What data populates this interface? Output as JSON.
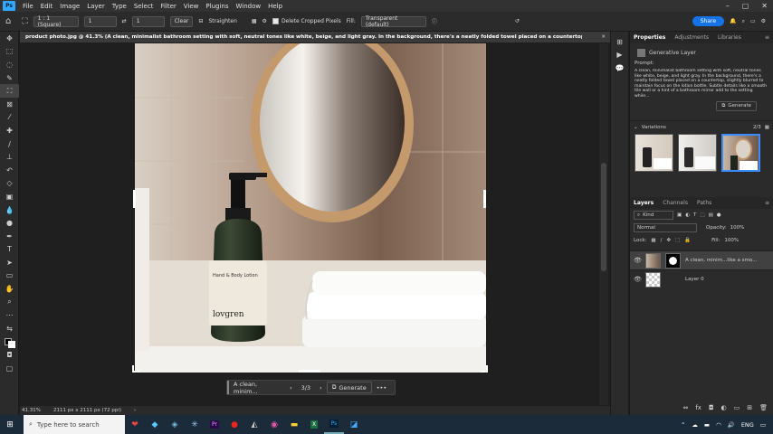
{
  "menubar": {
    "logo": "Ps",
    "items": [
      "File",
      "Edit",
      "Image",
      "Layer",
      "Type",
      "Select",
      "Filter",
      "View",
      "Plugins",
      "Window",
      "Help"
    ],
    "window_controls": [
      "–",
      "▢",
      "✕"
    ]
  },
  "options": {
    "ratio": "1 : 1 (Square)",
    "w": "1",
    "h": "1",
    "clear": "Clear",
    "straighten": "Straighten",
    "delete_cropped": "Delete Cropped Pixels",
    "fill_label": "Fill:",
    "fill_value": "Transparent (default)",
    "share": "Share"
  },
  "document": {
    "tab_title": "product photo.jpg @ 41.3% (A clean, minimalist bathroom setting with soft, neutral tones like white, beige, and light gray. In the background, there's a neatly folded towel placed on a countertop, slightly blurr...",
    "close": "✕",
    "bottle_label_line1": "Hand & Body Lotion",
    "bottle_brand": "lovgren"
  },
  "status": {
    "zoom": "41.31%",
    "dims": "2111 px x 2111 px (72 ppi)"
  },
  "contextbar": {
    "prompt": "A clean, minim...",
    "counter": "3/3",
    "generate": "Generate",
    "more": "•••"
  },
  "properties": {
    "tabs": [
      "Properties",
      "Adjustments",
      "Libraries"
    ],
    "layer_type": "Generative Layer",
    "prompt_label": "Prompt:",
    "prompt_text": "A clean, minimalist bathroom setting with soft, neutral tones like white, beige, and light gray. In the background, there's a neatly folded towel placed on a countertop, slightly blurred to maintain focus on the lotion bottle. Subtle details like a smooth tile wall or a hint of a bathroom mirror add to the setting while...",
    "generate": "Generate",
    "variations_label": "Variations",
    "variations_count": "2/3"
  },
  "layers": {
    "tabs": [
      "Layers",
      "Channels",
      "Paths"
    ],
    "kind": "Kind",
    "blend": "Normal",
    "opacity_label": "Opacity:",
    "opacity": "100%",
    "lock_label": "Lock:",
    "fill_label": "Fill:",
    "fill": "100%",
    "items": [
      {
        "name": "A clean, minim...like a smo..."
      },
      {
        "name": "Layer 0"
      }
    ]
  },
  "taskbar": {
    "search_placeholder": "Type here to search",
    "lang": "ENG"
  }
}
